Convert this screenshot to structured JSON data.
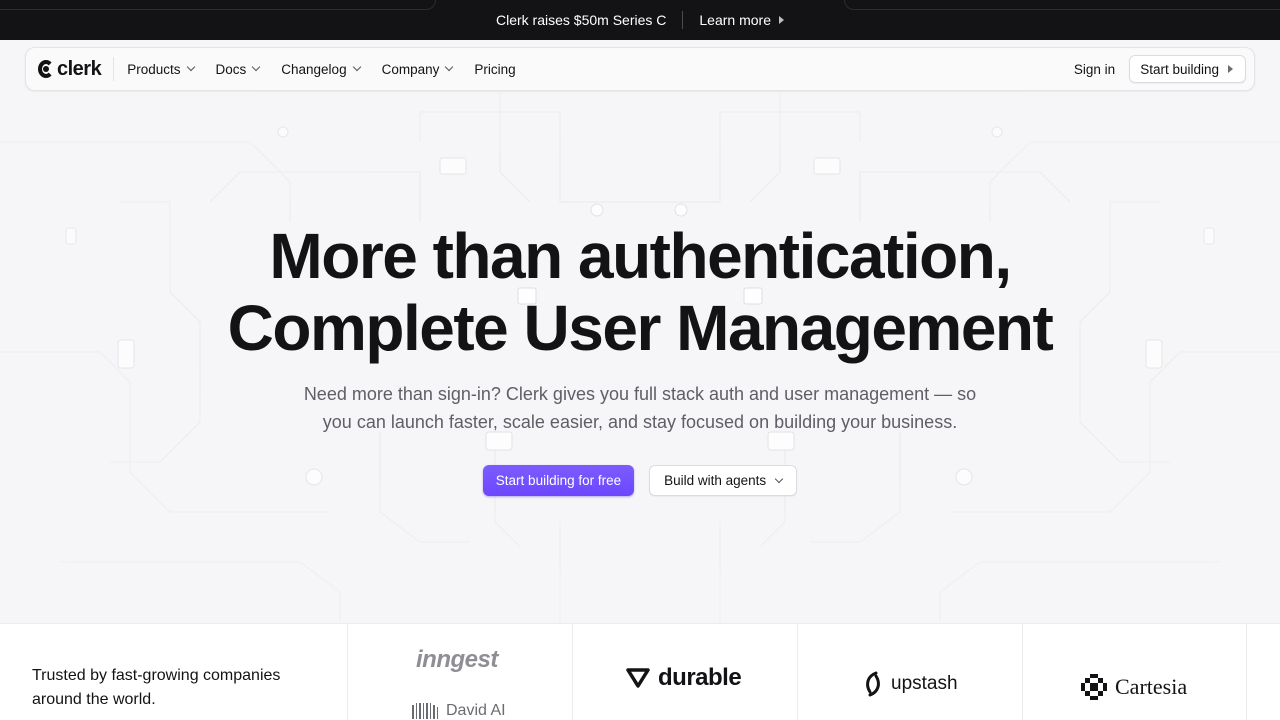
{
  "announcement": {
    "text": "Clerk raises $50m Series C",
    "link": "Learn more"
  },
  "nav": {
    "logo_text": "clerk",
    "items": [
      {
        "label": "Products",
        "has_dropdown": true
      },
      {
        "label": "Docs",
        "has_dropdown": true
      },
      {
        "label": "Changelog",
        "has_dropdown": true
      },
      {
        "label": "Company",
        "has_dropdown": true
      },
      {
        "label": "Pricing",
        "has_dropdown": false
      }
    ],
    "sign_in": "Sign in",
    "start_building": "Start building"
  },
  "hero": {
    "title_line1": "More than authentication,",
    "title_line2": "Complete User Management",
    "subtitle": "Need more than sign-in? Clerk gives you full stack auth and user management — so you can launch faster, scale easier, and stay focused on building your business.",
    "cta_primary": "Start building for free",
    "cta_secondary": "Build with agents"
  },
  "logos": {
    "trusted_text": "Trusted by fast-growing companies around the world.",
    "brands": [
      "inngest",
      "David AI",
      "durable",
      "upstash",
      "Cartesia"
    ]
  },
  "colors": {
    "accent": "#6c47ff",
    "dark": "#131316",
    "background": "#f6f6f8"
  }
}
